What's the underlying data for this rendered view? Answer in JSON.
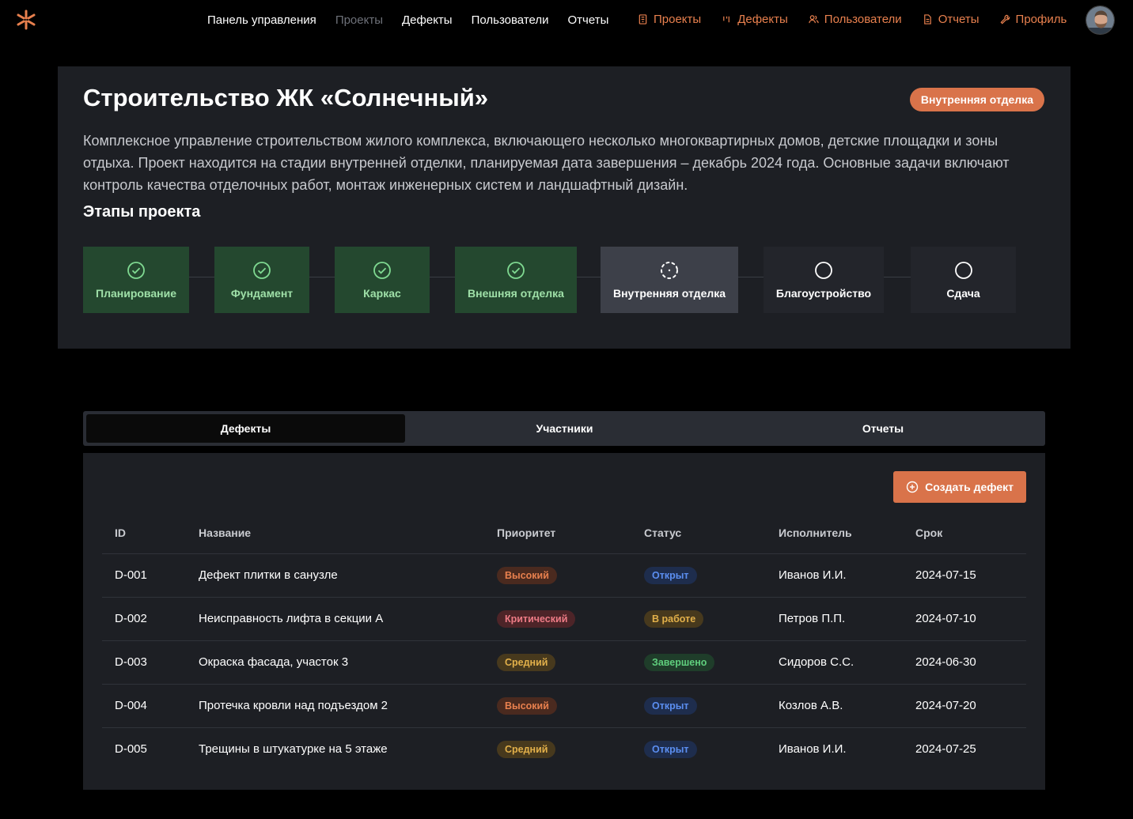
{
  "nav": {
    "main": [
      "Панель управления",
      "Проекты",
      "Дефекты",
      "Пользователи",
      "Отчеты"
    ],
    "quick": [
      {
        "label": "Проекты",
        "icon": "building-icon"
      },
      {
        "label": "Дефекты",
        "icon": "bug-icon"
      },
      {
        "label": "Пользователи",
        "icon": "users-icon"
      },
      {
        "label": "Отчеты",
        "icon": "file-icon"
      },
      {
        "label": "Профиль",
        "icon": "wrench-icon"
      }
    ],
    "accent_color": "#e8804e"
  },
  "project": {
    "title": "Строительство ЖК «Солнечный»",
    "phase_badge": "Внутренняя отделка",
    "description": "Комплексное управление строительством жилого комплекса, включающего несколько многоквартирных домов, детские площадки и зоны отдыха. Проект находится на стадии внутренней отделки, планируемая дата завершения – декабрь 2024 года. Основные задачи включают контроль качества отделочных работ, монтаж инженерных систем и ландшафтный дизайн.",
    "stages_title": "Этапы проекта",
    "stages": [
      {
        "label": "Планирование",
        "state": "done"
      },
      {
        "label": "Фундамент",
        "state": "done"
      },
      {
        "label": "Каркас",
        "state": "done"
      },
      {
        "label": "Внешняя отделка",
        "state": "done"
      },
      {
        "label": "Внутренняя отделка",
        "state": "current"
      },
      {
        "label": "Благоустройство",
        "state": "todo"
      },
      {
        "label": "Сдача",
        "state": "todo"
      }
    ]
  },
  "tabs": [
    "Дефекты",
    "Участники",
    "Отчеты"
  ],
  "defects": {
    "create_label": "Создать дефект",
    "columns": [
      "ID",
      "Название",
      "Приоритет",
      "Статус",
      "Исполнитель",
      "Срок"
    ],
    "rows": [
      {
        "id": "D-001",
        "name": "Дефект плитки в санузле",
        "priority": "Высокий",
        "status": "Открыт",
        "assignee": "Иванов И.И.",
        "due": "2024-07-15"
      },
      {
        "id": "D-002",
        "name": "Неисправность лифта в секции А",
        "priority": "Критический",
        "status": "В работе",
        "assignee": "Петров П.П.",
        "due": "2024-07-10"
      },
      {
        "id": "D-003",
        "name": "Окраска фасада, участок 3",
        "priority": "Средний",
        "status": "Завершено",
        "assignee": "Сидоров С.С.",
        "due": "2024-06-30"
      },
      {
        "id": "D-004",
        "name": "Протечка кровли над подъездом 2",
        "priority": "Высокий",
        "status": "Открыт",
        "assignee": "Козлов А.В.",
        "due": "2024-07-20"
      },
      {
        "id": "D-005",
        "name": "Трещины в штукатурке на 5 этаже",
        "priority": "Средний",
        "status": "Открыт",
        "assignee": "Иванов И.И.",
        "due": "2024-07-25"
      }
    ],
    "priority_colors": {
      "Высокий": {
        "bg": "#4a2a1f",
        "fg": "#e8804e"
      },
      "Критический": {
        "bg": "#4d2428",
        "fg": "#ee7b86"
      },
      "Средний": {
        "bg": "#47391d",
        "fg": "#e2b04a"
      }
    },
    "status_colors": {
      "Открыт": {
        "bg": "#1e2d4d",
        "fg": "#5b8ef0"
      },
      "В работе": {
        "bg": "#47391d",
        "fg": "#e2b04a"
      },
      "Завершено": {
        "bg": "#1f3d2a",
        "fg": "#5fce7d"
      }
    }
  }
}
